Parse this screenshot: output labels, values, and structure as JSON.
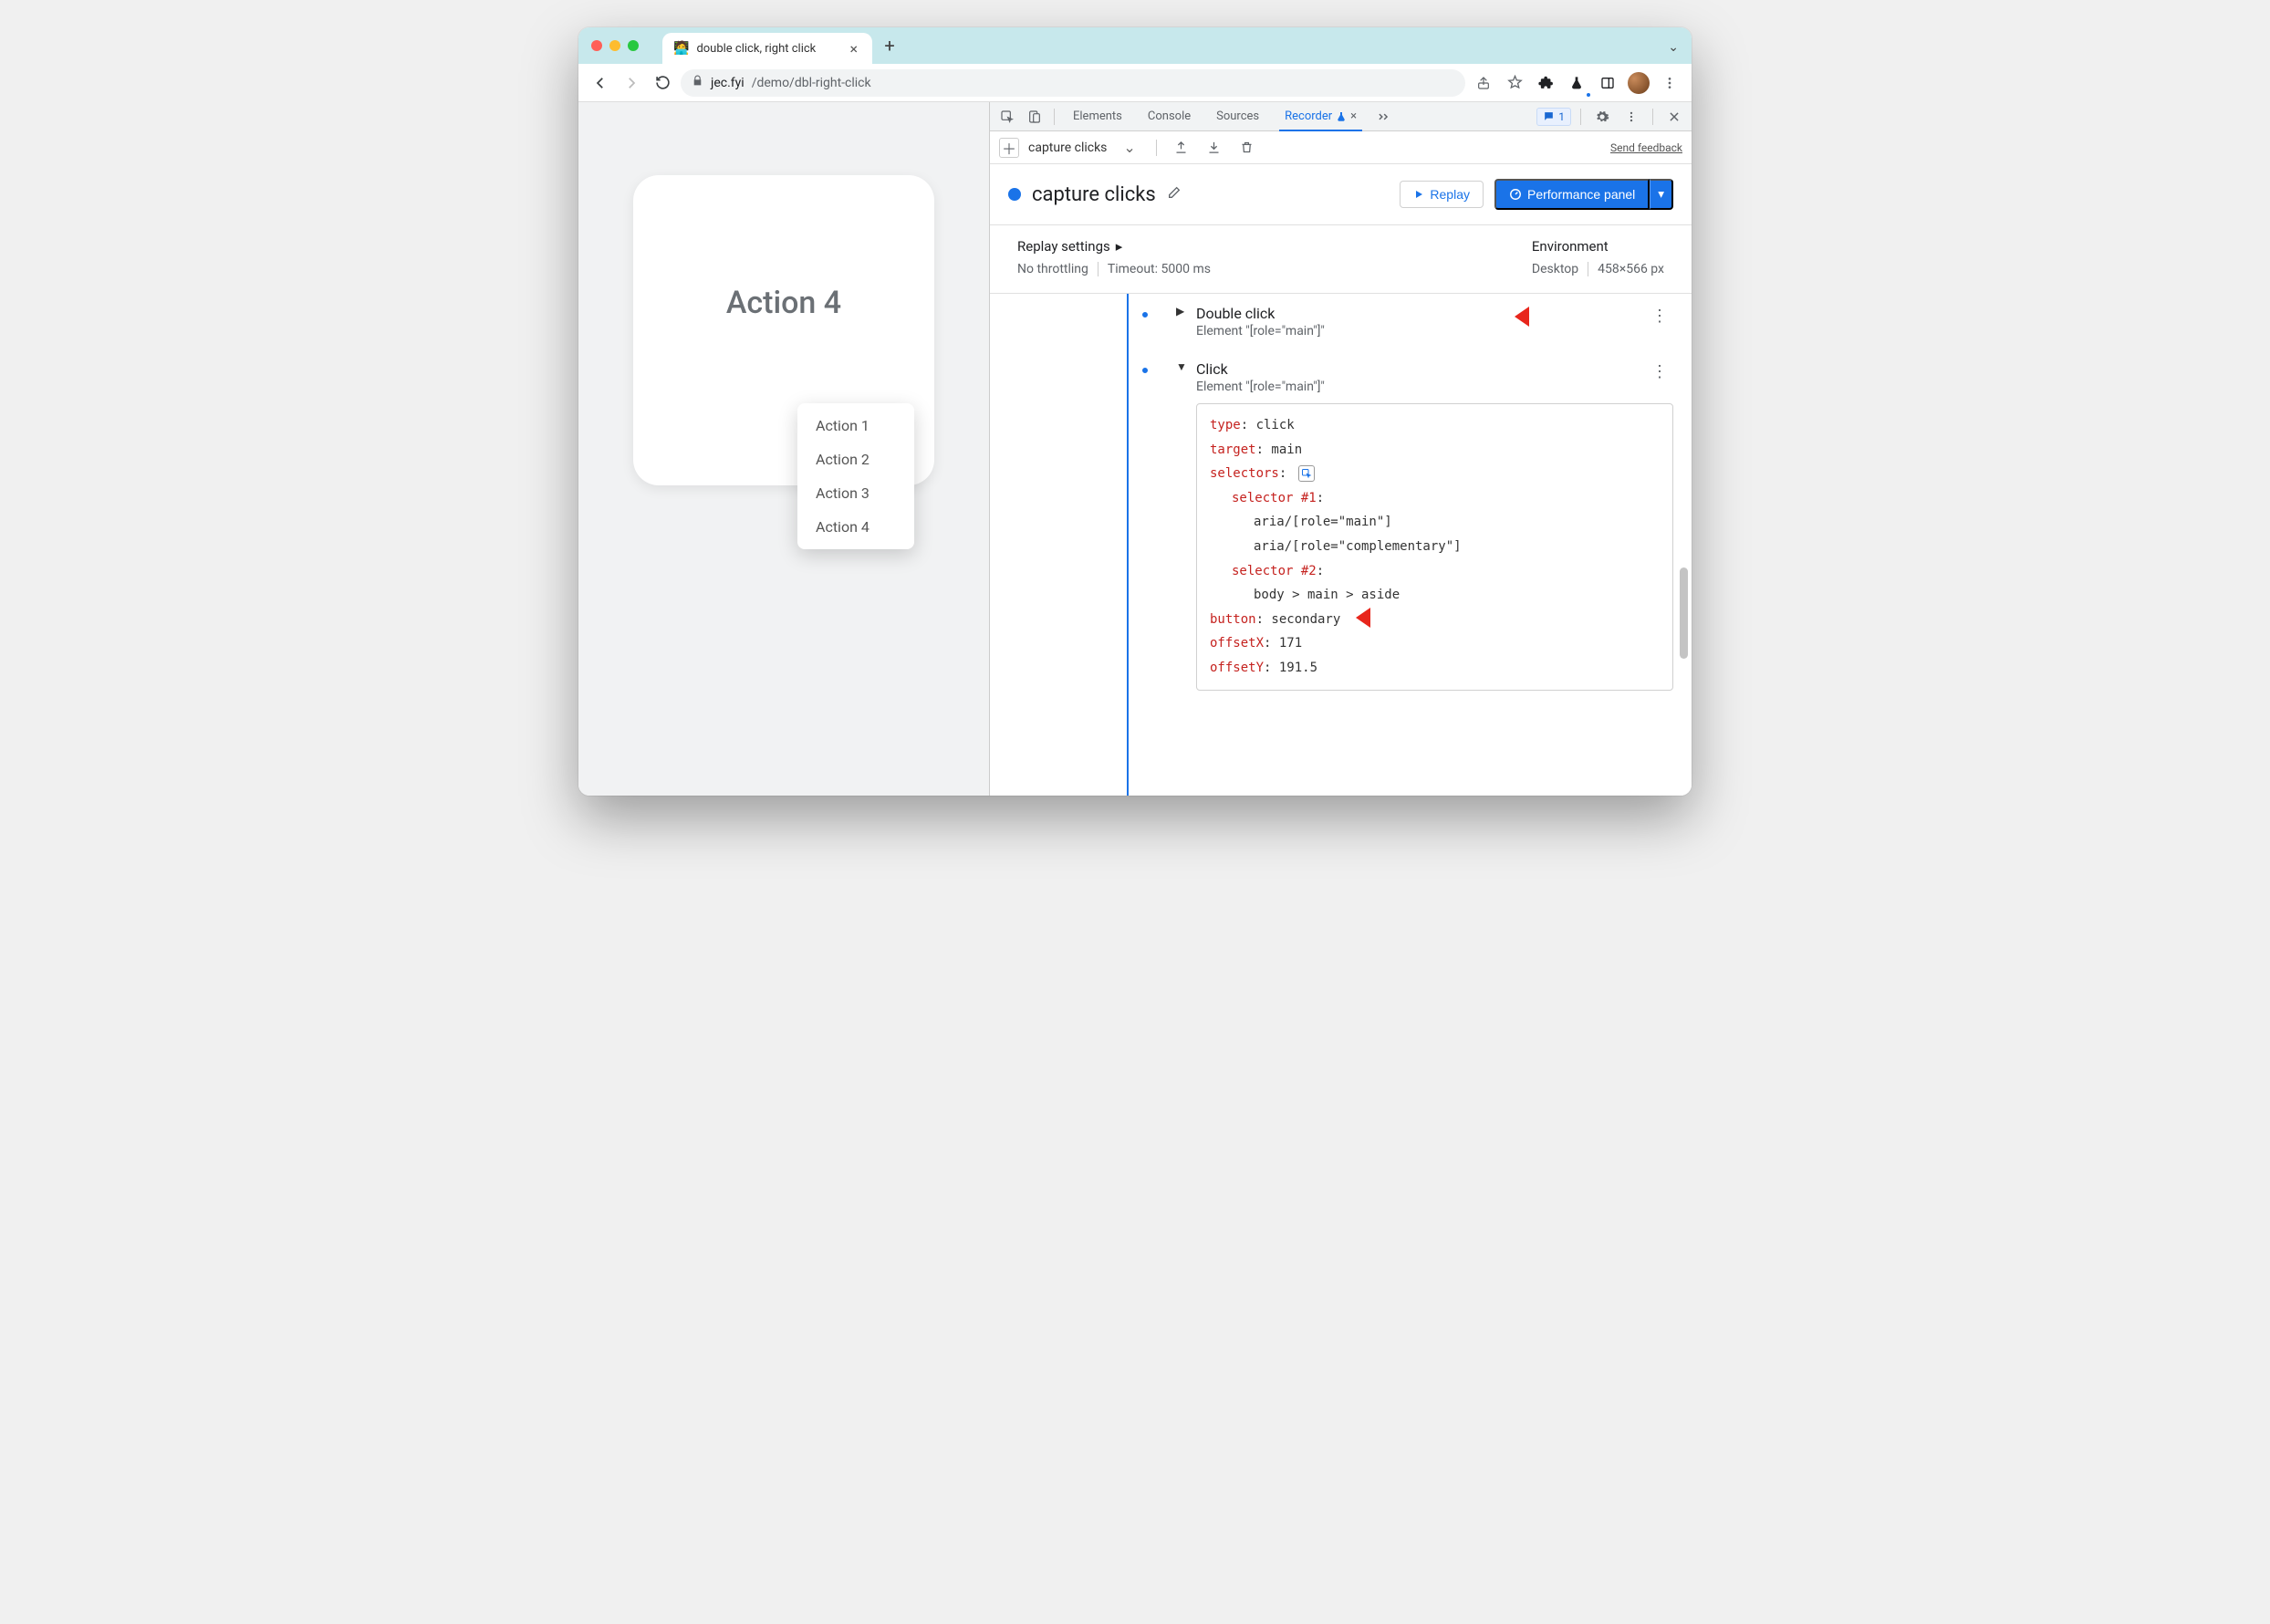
{
  "browser": {
    "tab_title": "double click, right click",
    "url_host": "jec.fyi",
    "url_path": "/demo/dbl-right-click"
  },
  "page": {
    "card_title": "Action 4",
    "context_menu": [
      "Action 1",
      "Action 2",
      "Action 3",
      "Action 4"
    ]
  },
  "devtools": {
    "tabs": {
      "elements": "Elements",
      "console": "Console",
      "sources": "Sources",
      "recorder": "Recorder"
    },
    "issues_count": "1",
    "subbar_name": "capture clicks",
    "send_feedback": "Send feedback",
    "rec_title": "capture clicks",
    "replay_label": "Replay",
    "perf_label": "Performance panel",
    "replay_settings_label": "Replay settings",
    "no_throttling": "No throttling",
    "timeout_label": "Timeout: 5000 ms",
    "environment_label": "Environment",
    "env_device": "Desktop",
    "env_size": "458×566 px",
    "step1": {
      "title": "Double click",
      "subtitle": "Element \"[role=\"main\"]\""
    },
    "step2": {
      "title": "Click",
      "subtitle": "Element \"[role=\"main\"]\"",
      "details": {
        "type_key": "type",
        "type_val": ": click",
        "target_key": "target",
        "target_val": ": main",
        "selectors_key": "selectors",
        "selectors_colon": ":",
        "sel1_key": "selector #1",
        "sel1_colon": ":",
        "sel1_a": "aria/[role=\"main\"]",
        "sel1_b": "aria/[role=\"complementary\"]",
        "sel2_key": "selector #2",
        "sel2_colon": ":",
        "sel2_a": "body > main > aside",
        "button_key": "button",
        "button_val": ": secondary",
        "offx_key": "offsetX",
        "offx_val": ": 171",
        "offy_key": "offsetY",
        "offy_val": ": 191.5"
      }
    }
  }
}
